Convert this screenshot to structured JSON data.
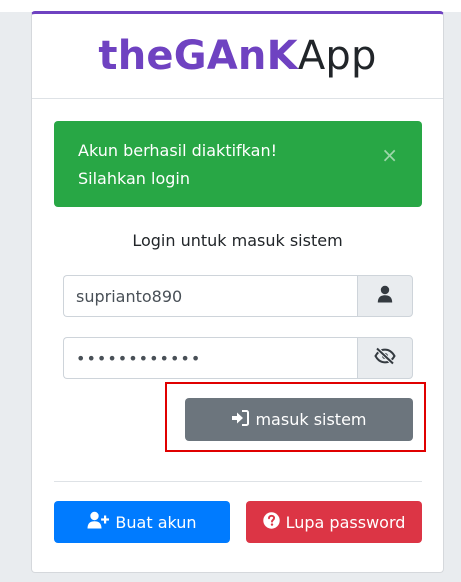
{
  "header": {
    "brand_bold": "theGAnK",
    "brand_light": "App"
  },
  "alert": {
    "line1": "Akun berhasil diaktifkan!",
    "line2": "Silahkan login",
    "close_symbol": "×",
    "color": "#28a745"
  },
  "login": {
    "message": "Login untuk masuk sistem",
    "username_value": "suprianto890",
    "password_value": "••••••••••••",
    "username_icon": "user-icon",
    "password_icon": "eye-slash-icon"
  },
  "buttons": {
    "submit_label": "masuk sistem",
    "submit_icon": "sign-in-icon",
    "register_label": "Buat akun",
    "register_icon": "user-plus-icon",
    "forgot_label": "Lupa password",
    "forgot_icon": "question-circle-icon"
  },
  "colors": {
    "brand": "#6f42c1",
    "submit": "#6c757d",
    "register": "#007bff",
    "forgot": "#dc3545",
    "highlight": "#e00000"
  }
}
